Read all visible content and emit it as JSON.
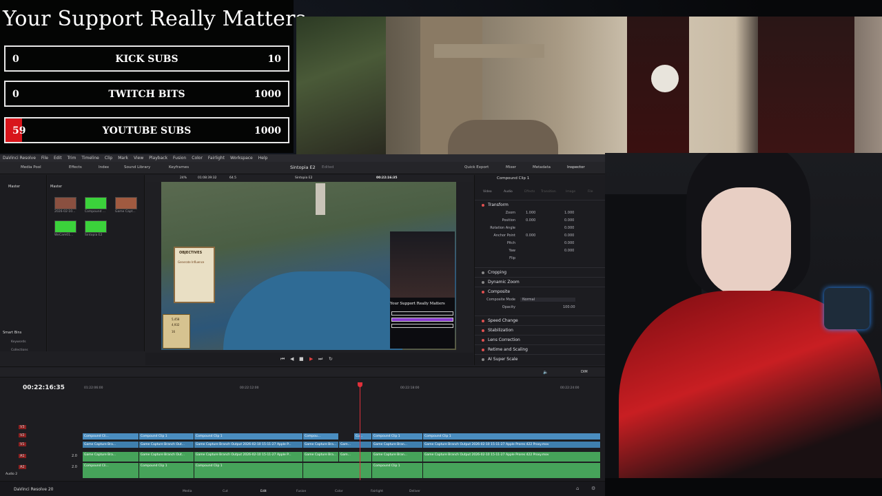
{
  "goals": {
    "title": "Your Support Really Matters",
    "items": [
      {
        "current": "0",
        "label": "KICK SUBS",
        "max": "10",
        "progress": 0
      },
      {
        "current": "0",
        "label": "TWITCH BITS",
        "max": "1000",
        "progress": 0
      },
      {
        "current": "59",
        "label": "YOUTUBE SUBS",
        "max": "1000",
        "progress": 0.059
      }
    ]
  },
  "resolve": {
    "app_title": "DaVinci Resolve",
    "menu": [
      "File",
      "Edit",
      "Trim",
      "Timeline",
      "Clip",
      "Mark",
      "View",
      "Playback",
      "Fusion",
      "Color",
      "Fairlight",
      "Workspace",
      "Help"
    ],
    "toolbar": {
      "media_pool": "Media Pool",
      "effects": "Effects",
      "index": "Index",
      "sound_library": "Sound Library",
      "keyframes": "Keyframes",
      "project_name": "Sintopia E2",
      "edited": "Edited",
      "quick_export": "Quick Export",
      "mixer": "Mixer",
      "metadata": "Metadata",
      "inspector": "Inspector"
    },
    "viewer": {
      "zoom": "24%",
      "duration": "01:08:39:32",
      "fps": "64.5",
      "timeline_name": "Sintopia E2",
      "timecode": "00:22:16:35"
    },
    "media_pool": {
      "bin_left": "Master",
      "bin_right": "Master",
      "clips": [
        {
          "label": "2026-02-10...",
          "color": "#8a5040"
        },
        {
          "label": "Compound ...",
          "color": "#3bd23b"
        },
        {
          "label": "Game Capt...",
          "color": "#a05a40"
        },
        {
          "label": "WeCam01...",
          "color": "#3bd23b"
        },
        {
          "label": "Sintopia E2",
          "color": "#3bd23b"
        }
      ],
      "smart_bins": "Smart Bins",
      "keywords": "Keywords",
      "collections": "Collections"
    },
    "inspector": {
      "clip_name": "Compound Clip 1",
      "tabs": [
        "Video",
        "Audio",
        "Effects",
        "Transition",
        "Image",
        "File"
      ],
      "transform": "Transform",
      "rows": [
        {
          "label": "Zoom",
          "x": "1.000",
          "y": "1.000"
        },
        {
          "label": "Position",
          "x": "0.000",
          "y": "0.000"
        },
        {
          "label": "Rotation Angle",
          "x": "",
          "y": "0.000"
        },
        {
          "label": "Anchor Point",
          "x": "0.000",
          "y": "0.000"
        },
        {
          "label": "Pitch",
          "x": "",
          "y": "0.000"
        },
        {
          "label": "Yaw",
          "x": "",
          "y": "0.000"
        },
        {
          "label": "Flip",
          "x": "",
          "y": ""
        }
      ],
      "sections": [
        "Cropping",
        "Dynamic Zoom",
        "Composite",
        "Speed Change",
        "Stabilization",
        "Lens Correction",
        "Retime and Scaling",
        "AI Super Scale"
      ],
      "composite_mode_label": "Composite Mode",
      "composite_mode": "Normal",
      "opacity_label": "Opacity",
      "opacity": "100.00"
    },
    "timeline": {
      "timecode": "00:22:16:35",
      "ruler": [
        "01:22:06:00",
        "00:22:12:00",
        "00:22:18:00",
        "00:22:24:00"
      ],
      "tracks": [
        "V3",
        "V2",
        "V1",
        "A1",
        "A2"
      ],
      "audio2_label": "Audio 2",
      "track_level": "2.0",
      "dim": "DIM",
      "v2_clips": [
        "Compound Cli...",
        "Compound Clip 1",
        "Compound Clip 1",
        "Compou...",
        "Cu...",
        "Compound Clip 1",
        "Compound Clip 1"
      ],
      "v1_clips": [
        "Game Capture Bra...",
        "Game Capture Branch Out...",
        "Game Capture Branch Output 2026-02-10 15-11-27 Apple P...",
        "Game Capture Bra...",
        "Gam...",
        "Game Capture Bran...",
        "Game Capture Branch Output 2026-02-10 15-11-27 Apple Prores 422 Proxy.mov"
      ],
      "a1_clips": [
        "Game Capture Bra...",
        "Game Capture Branch Out...",
        "Game Capture Branch Output 2026-02-10 15-11-27 Apple P...",
        "Game Capture Bra...",
        "Gam...",
        "Game Capture Bran...",
        "Game Capture Branch Output 2026-02-10 15-11-27 Apple Prores 422 Proxy.mov"
      ],
      "a2_clips": [
        "Compound Cli...",
        "Compound Clip 1",
        "Compound Clip 1",
        "",
        "",
        "Compound Clip 1",
        ""
      ]
    },
    "pages": [
      "Media",
      "Cut",
      "Edit",
      "Fusion",
      "Color",
      "Fairlight",
      "Deliver"
    ],
    "active_page": "Edit",
    "brand": "DaVinci Resolve 20"
  },
  "game": {
    "objectives_title": "OBJECTIVES",
    "objectives_sub": "Generate Influence",
    "mini_overlay_title": "Your Support Really Matters",
    "counter_a": "5,458",
    "counter_b": "4,932",
    "counter_c": "16"
  },
  "colors": {
    "goal_fill": "#d8151b",
    "video_clip": "#4a8dc0",
    "audio_clip": "#46a35a",
    "playhead": "#e0303a"
  }
}
